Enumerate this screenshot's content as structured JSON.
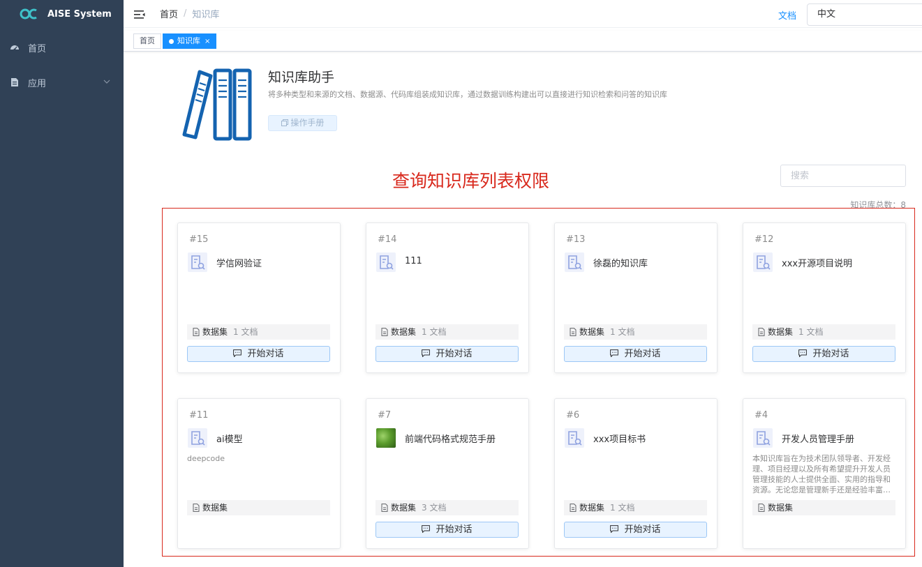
{
  "app": {
    "title": "AISE System"
  },
  "sidebar": {
    "items": [
      {
        "label": "首页",
        "icon": "dashboard-icon"
      },
      {
        "label": "应用",
        "icon": "document-icon"
      }
    ]
  },
  "navbar": {
    "breadcrumb": [
      "首页",
      "知识库"
    ],
    "doc_link": "文档",
    "language": "中文"
  },
  "tags": [
    {
      "label": "首页",
      "active": false
    },
    {
      "label": "知识库",
      "active": true,
      "close": "×"
    }
  ],
  "header": {
    "title": "知识库助手",
    "description": "将多种类型和来源的文档、数据源、代码库组装成知识库，通过数据训练构建出可以直接进行知识检索和问答的知识库",
    "manual_button": "操作手册"
  },
  "annotation": "查询知识库列表权限",
  "search": {
    "placeholder": "搜索"
  },
  "total_count": "知识库总数：8",
  "colors": {
    "sidebar_bg": "#304156",
    "accent": "#1890ff",
    "annotation_red": "#d8281c"
  },
  "cards": [
    {
      "id": "#15",
      "name": "学信网验证",
      "desc": "",
      "meta_label": "数据集",
      "meta_count": "1 文档",
      "button": "开始对话",
      "icon": "knowledge-doc-icon"
    },
    {
      "id": "#14",
      "name": "111",
      "desc": "",
      "meta_label": "数据集",
      "meta_count": "1 文档",
      "button": "开始对话",
      "icon": "knowledge-doc-icon"
    },
    {
      "id": "#13",
      "name": "徐磊的知识库",
      "desc": "",
      "meta_label": "数据集",
      "meta_count": "1 文档",
      "button": "开始对话",
      "icon": "knowledge-doc-icon"
    },
    {
      "id": "#12",
      "name": "xxx开源项目说明",
      "desc": "",
      "meta_label": "数据集",
      "meta_count": "1 文档",
      "button": "开始对话",
      "icon": "knowledge-doc-icon"
    },
    {
      "id": "#11",
      "name": "ai模型",
      "desc": "deepcode",
      "meta_label": "数据集",
      "meta_count": "",
      "button": "",
      "icon": "knowledge-doc-icon"
    },
    {
      "id": "#7",
      "name": "前端代码格式规范手册",
      "desc": "",
      "meta_label": "数据集",
      "meta_count": "3 文档",
      "button": "开始对话",
      "icon": "green-leaf-image"
    },
    {
      "id": "#6",
      "name": "xxx项目标书",
      "desc": "",
      "meta_label": "数据集",
      "meta_count": "1 文档",
      "button": "开始对话",
      "icon": "knowledge-doc-icon"
    },
    {
      "id": "#4",
      "name": "开发人员管理手册",
      "desc": "本知识库旨在为技术团队领导者、开发经理、项目经理以及所有希望提升开发人员管理技能的人士提供全面、实用的指导和资源。无论您是管理新手还是经验丰富的管理者",
      "meta_label": "数据集",
      "meta_count": "",
      "button": "",
      "icon": "knowledge-doc-icon"
    }
  ]
}
